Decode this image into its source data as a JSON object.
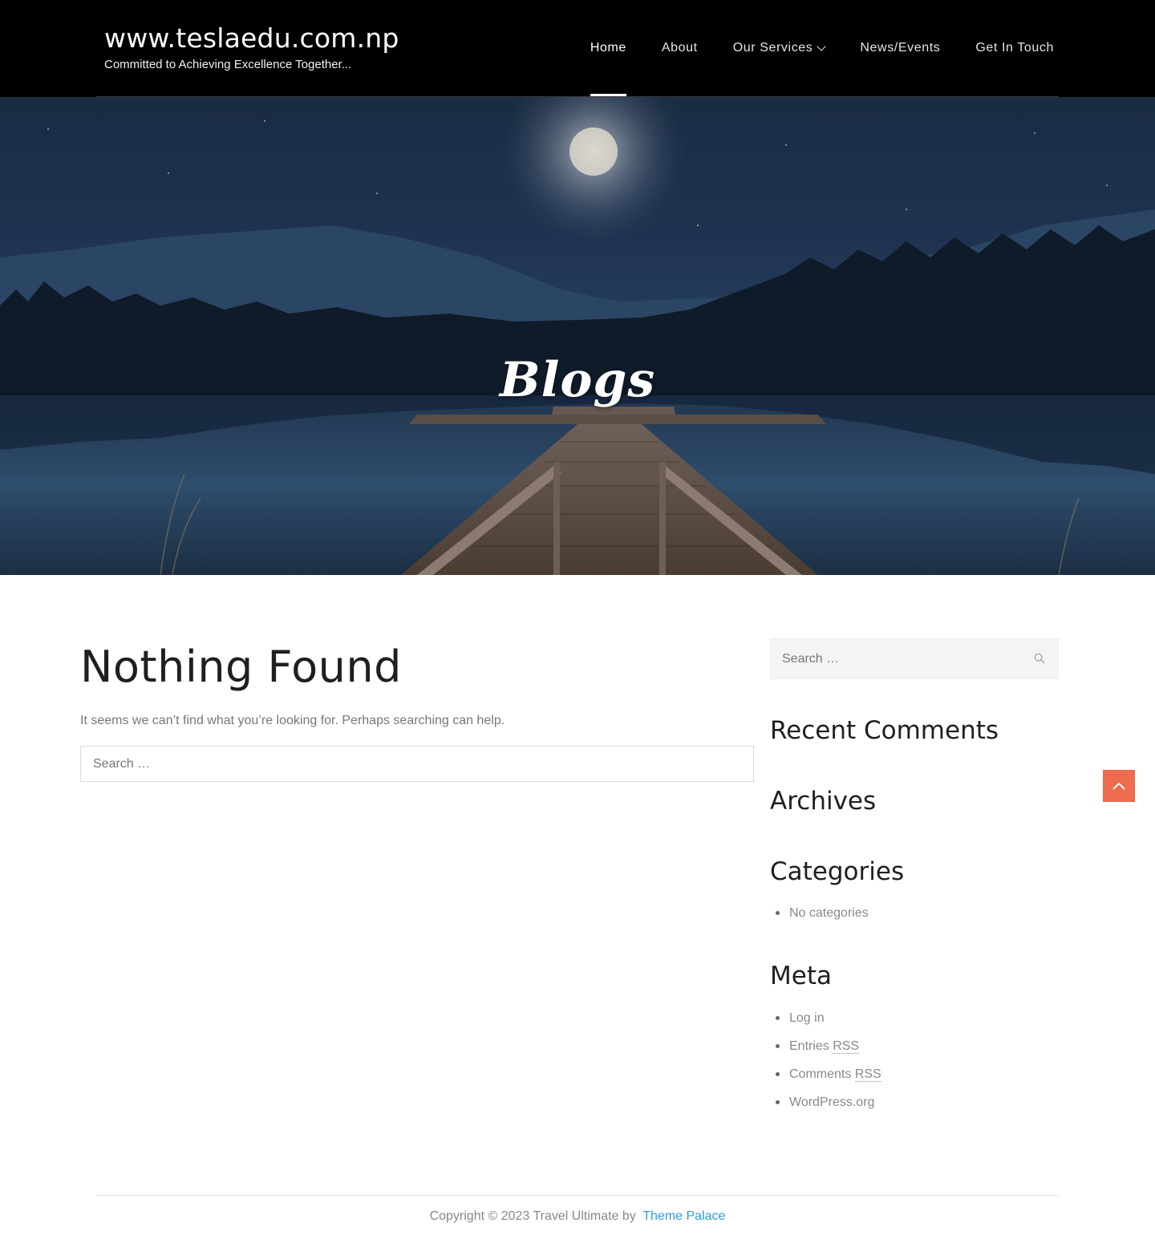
{
  "header": {
    "site_title": "www.teslaedu.com.np",
    "tagline": "Committed to Achieving Excellence Together...",
    "nav": [
      {
        "label": "Home",
        "active": true
      },
      {
        "label": "About",
        "active": false
      },
      {
        "label": "Our Services",
        "active": false,
        "has_dropdown": true
      },
      {
        "label": "News/Events",
        "active": false
      },
      {
        "label": "Get In Touch",
        "active": false
      }
    ]
  },
  "hero": {
    "title": "Blogs"
  },
  "main": {
    "heading": "Nothing Found",
    "message": "It seems we can’t find what you’re looking for. Perhaps searching can help.",
    "search_placeholder": "Search …"
  },
  "sidebar": {
    "search_placeholder": "Search …",
    "recent_comments_title": "Recent Comments",
    "archives_title": "Archives",
    "categories_title": "Categories",
    "categories": [
      "No categories"
    ],
    "meta_title": "Meta",
    "meta_links": {
      "login": "Log in",
      "entries": "Entries",
      "comments": "Comments",
      "rss": "RSS",
      "wordpress": "WordPress.org"
    }
  },
  "footer": {
    "copyright": "Copyright © 2023 Travel Ultimate by",
    "link_text": "Theme Palace"
  },
  "colors": {
    "header_bg": "#000000",
    "accent": "#ef6b4d",
    "link": "#2a9fd8"
  },
  "icons": [
    "chevron-down-icon",
    "search-icon",
    "arrow-up-icon"
  ]
}
